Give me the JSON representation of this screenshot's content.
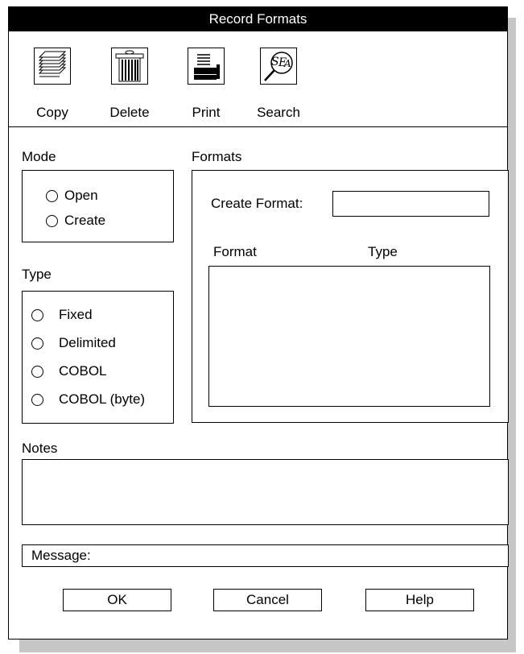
{
  "window": {
    "title": "Record Formats"
  },
  "toolbar": {
    "items": [
      {
        "label": "Copy",
        "icon": "copy-icon"
      },
      {
        "label": "Delete",
        "icon": "trash-can-icon"
      },
      {
        "label": "Print",
        "icon": "printer-icon"
      },
      {
        "label": "Search",
        "icon": "search-icon"
      }
    ]
  },
  "mode": {
    "label": "Mode",
    "options": [
      "Open",
      "Create"
    ]
  },
  "type": {
    "label": "Type",
    "options": [
      "Fixed",
      "Delimited",
      "COBOL",
      "COBOL (byte)"
    ]
  },
  "formats": {
    "label": "Formats",
    "create_label": "Create Format:",
    "create_value": "",
    "columns": [
      "Format",
      "Type"
    ]
  },
  "notes": {
    "label": "Notes",
    "value": ""
  },
  "message": {
    "label": "Message:"
  },
  "buttons": {
    "ok": "OK",
    "cancel": "Cancel",
    "help": "Help"
  }
}
